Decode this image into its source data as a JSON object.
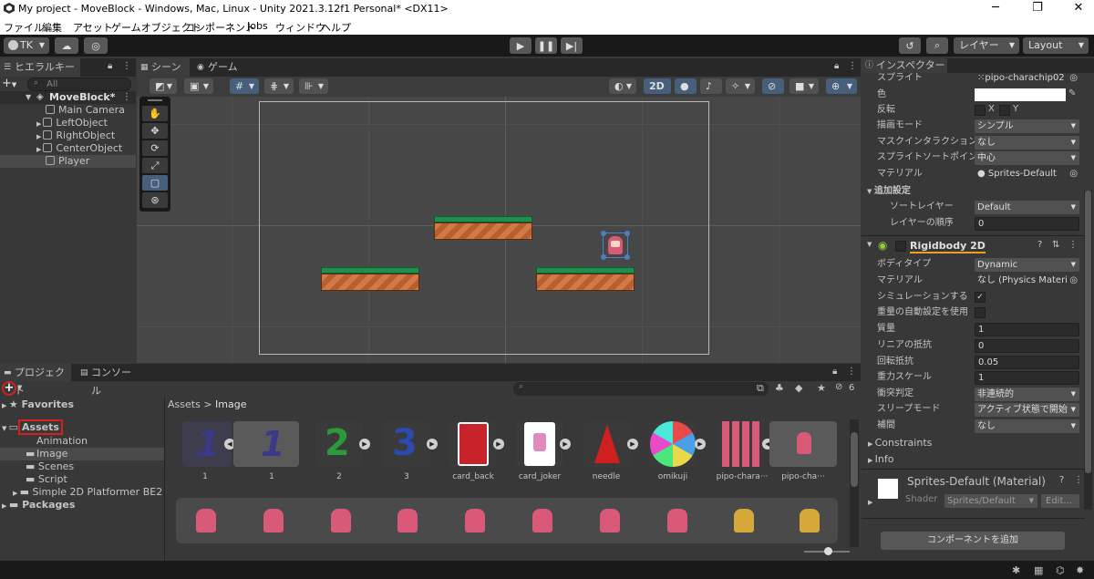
{
  "window": {
    "title": "My project - MoveBlock - Windows, Mac, Linux - Unity 2021.3.12f1 Personal* <DX11>"
  },
  "menu": [
    "ファイル",
    "編集",
    "アセット",
    "ゲームオブジェクト",
    "コンポーネント",
    "Jobs",
    "ウィンドウ",
    "ヘルプ"
  ],
  "toolbar": {
    "account": "TK",
    "layers": "レイヤー",
    "layout": "Layout"
  },
  "hierarchy": {
    "tab": "ヒエラルキー",
    "search_placeholder": "All",
    "scene": "MoveBlock*",
    "items": [
      "Main Camera",
      "LeftObject",
      "RightObject",
      "CenterObject",
      "Player"
    ]
  },
  "scene": {
    "tab_scene": "シーン",
    "tab_game": "ゲーム",
    "mode_2d": "2D"
  },
  "project": {
    "tab_project": "プロジェクト",
    "tab_console": "コンソール",
    "favorites": "Favorites",
    "assets": "Assets",
    "folders": [
      "Animation",
      "Image",
      "Scenes",
      "Script",
      "Simple 2D Platformer BE2"
    ],
    "packages": "Packages",
    "breadcrumb_root": "Assets",
    "breadcrumb_sep": ">",
    "breadcrumb_current": "Image",
    "count": "6",
    "asset_labels": [
      "1",
      "1",
      "2",
      "3",
      "card_back",
      "card_joker",
      "needle",
      "omikuji",
      "pipo-chara···",
      "pipo-cha···"
    ]
  },
  "inspector": {
    "tab": "インスペクター",
    "rows": [
      {
        "label": "スプライト",
        "value": "pipo-charachip02"
      },
      {
        "label": "色",
        "value": ""
      },
      {
        "label": "反転",
        "value": "X   Y"
      },
      {
        "label": "描画モード",
        "value": "シンプル"
      },
      {
        "label": "マスクインタラクション",
        "value": "なし"
      },
      {
        "label": "スプライトソートポイント",
        "value": "中心"
      },
      {
        "label": "マテリアル",
        "value": "Sprites-Default"
      }
    ],
    "extra_settings": "追加設定",
    "sort_layer_label": "ソートレイヤー",
    "sort_layer_value": "Default",
    "order_label": "レイヤーの順序",
    "order_value": "0",
    "rigidbody_title": "Rigidbody 2D",
    "rb_rows": [
      {
        "label": "ボディタイプ",
        "value": "Dynamic"
      },
      {
        "label": "マテリアル",
        "value": "なし (Physics Materi"
      },
      {
        "label": "シミュレーションする",
        "value": "✓"
      },
      {
        "label": "重量の自動設定を使用",
        "value": ""
      },
      {
        "label": "質量",
        "value": "1"
      },
      {
        "label": "リニアの抵抗",
        "value": "0"
      },
      {
        "label": "回転抵抗",
        "value": "0.05"
      },
      {
        "label": "重力スケール",
        "value": "1"
      },
      {
        "label": "衝突判定",
        "value": "非連続的"
      },
      {
        "label": "スリープモード",
        "value": "アクティブ状態で開始"
      },
      {
        "label": "補間",
        "value": "なし"
      }
    ],
    "constraints": "Constraints",
    "info": "Info",
    "material_title": "Sprites-Default (Material)",
    "shader_label": "Shader",
    "shader_value": "Sprites/Default",
    "edit": "Edit...",
    "add_component": "コンポーネントを追加"
  }
}
